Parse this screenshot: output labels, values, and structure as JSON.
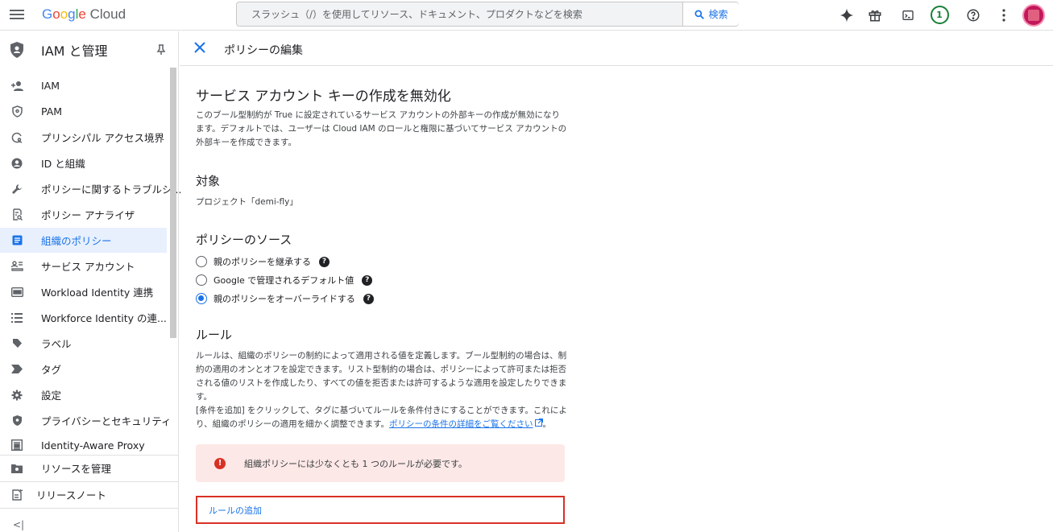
{
  "topbar": {
    "logo_google": [
      "G",
      "o",
      "o",
      "g",
      "l",
      "e"
    ],
    "logo_cloud": "Cloud",
    "search_placeholder": "スラッシュ（/）を使用してリソース、ドキュメント、プロダクトなどを検索",
    "search_button": "検索",
    "notification_count": "1"
  },
  "sidebar": {
    "title": "IAM と管理",
    "items": [
      {
        "label": "IAM",
        "icon": "person-add-icon"
      },
      {
        "label": "PAM",
        "icon": "shield-icon"
      },
      {
        "label": "プリンシパル アクセス境界",
        "icon": "principal-boundary-icon"
      },
      {
        "label": "ID と組織",
        "icon": "account-circle-icon"
      },
      {
        "label": "ポリシーに関するトラブルシ...",
        "icon": "wrench-icon"
      },
      {
        "label": "ポリシー アナライザ",
        "icon": "analyzer-icon"
      },
      {
        "label": "組織のポリシー",
        "icon": "document-icon",
        "active": true
      },
      {
        "label": "サービス アカウント",
        "icon": "service-account-icon"
      },
      {
        "label": "Workload Identity 連携",
        "icon": "id-card-icon"
      },
      {
        "label": "Workforce Identity の連...",
        "icon": "list-icon"
      },
      {
        "label": "ラベル",
        "icon": "label-icon"
      },
      {
        "label": "タグ",
        "icon": "tag-icon"
      },
      {
        "label": "設定",
        "icon": "gear-icon"
      },
      {
        "label": "プライバシーとセキュリティ",
        "icon": "shield-icon"
      },
      {
        "label": "Identity-Aware Proxy",
        "icon": "proxy-icon"
      }
    ],
    "bottom_items": [
      {
        "label": "リソースを管理",
        "icon": "folder-icon"
      },
      {
        "label": "リリースノート",
        "icon": "notes-icon"
      }
    ]
  },
  "panel": {
    "title": "ポリシーの編集",
    "heading": "サービス アカウント キーの作成を無効化",
    "description": "このブール型制約が True に設定されているサービス アカウントの外部キーの作成が無効になります。デフォルトでは、ユーザーは Cloud IAM のロールと権限に基づいてサービス アカウントの外部キーを作成できます。",
    "target_heading": "対象",
    "target_value": "プロジェクト「demi-fly」",
    "source_heading": "ポリシーのソース",
    "source_options": [
      {
        "label": "親のポリシーを継承する",
        "selected": false
      },
      {
        "label": "Google で管理されるデフォルト値",
        "selected": false
      },
      {
        "label": "親のポリシーをオーバーライドする",
        "selected": true
      }
    ],
    "rules_heading": "ルール",
    "rules_desc1": "ルールは、組織のポリシーの制約によって適用される値を定義します。ブール型制約の場合は、制約の適用のオンとオフを設定できます。リスト型制約の場合は、ポリシーによって許可または拒否される値のリストを作成したり、すべての値を拒否または許可するような適用を設定したりできます。",
    "rules_desc2_prefix": "[条件を追加] をクリックして、タグに基づいてルールを条件付きにすることができます。これにより、組織のポリシーの適用を細かく調整できます。",
    "rules_desc2_link": "ポリシーの条件の詳細をご覧ください",
    "rules_desc2_suffix": "。",
    "error_text": "組織ポリシーには少なくとも 1 つのルールが必要です。",
    "add_rule": "ルールの追加"
  }
}
